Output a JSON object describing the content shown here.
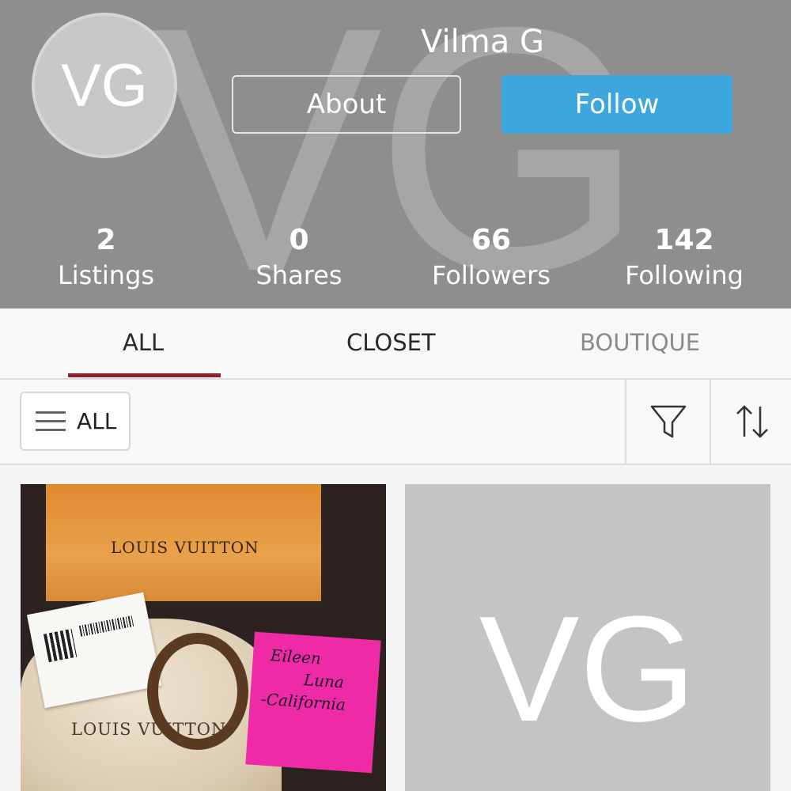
{
  "profile": {
    "name": "Vilma G",
    "initials": "VG",
    "about_label": "About",
    "follow_label": "Follow"
  },
  "stats": [
    {
      "value": "2",
      "label": "Listings"
    },
    {
      "value": "0",
      "label": "Shares"
    },
    {
      "value": "66",
      "label": "Followers"
    },
    {
      "value": "142",
      "label": "Following"
    }
  ],
  "tabs": [
    {
      "label": "ALL",
      "active": true
    },
    {
      "label": "CLOSET",
      "active": false
    },
    {
      "label": "BOUTIQUE",
      "active": false
    }
  ],
  "filter": {
    "dropdown_label": "ALL",
    "icons": [
      "menu-icon",
      "filter-icon",
      "sort-icon"
    ]
  },
  "listings": [
    {
      "image": "photo",
      "box_text": "LOUIS VUITTON",
      "pouch_text": "LOUIS VUITTON",
      "note_lines": [
        "Eileen",
        "Luna",
        "-California"
      ]
    },
    {
      "image": "placeholder",
      "initials": "VG"
    }
  ],
  "colors": {
    "header_bg": "#8e8e8e",
    "follow_button": "#3ea6df",
    "active_tab_underline": "#8f1f2c",
    "inactive_tab_text": "#8c8c8c"
  }
}
